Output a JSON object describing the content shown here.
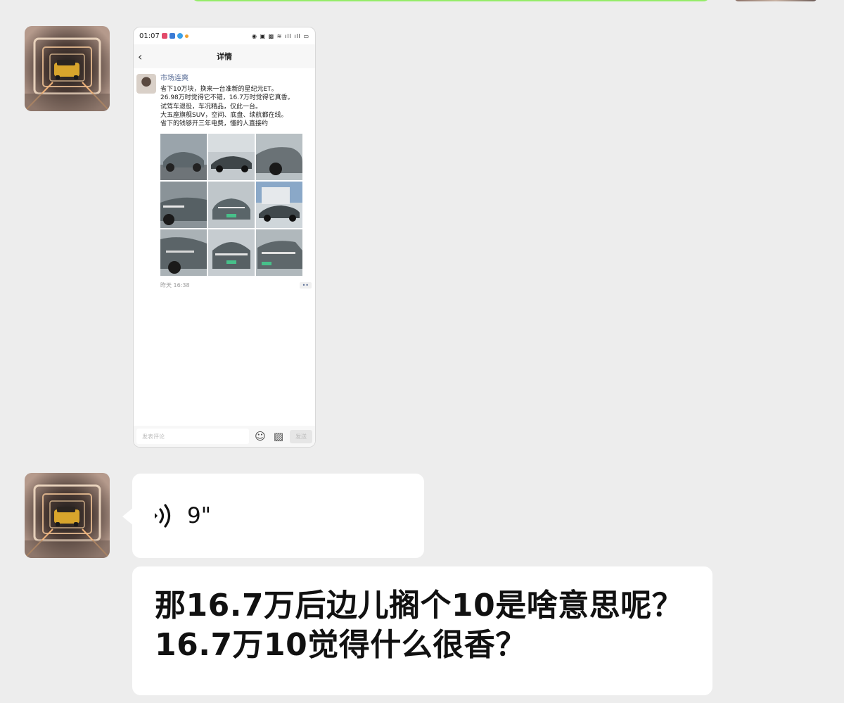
{
  "screenshot": {
    "status_time": "01:07",
    "nav_title": "详情",
    "post": {
      "author": "市场连爽",
      "text": "省下10万块，换来一台准新的星纪元ET。\n26.98万时觉得它不错，16.7万时觉得它真香。\n试驾车退役，车况精品，仅此一台。\n大五座旗舰SUV，空间、底盘、续航都在线。\n省下的钱够开三年电费，懂的人直接约",
      "time": "昨天 16:38",
      "more": "••"
    },
    "comment_placeholder": "发表评论",
    "send_label": "发送"
  },
  "voice_message": {
    "duration": "9\""
  },
  "text_message": {
    "content": "那16.7万后边儿搁个10是啥意思呢？16.7万10觉得什么很香？"
  },
  "colors": {
    "chat_background": "#ededed",
    "bubble": "#ffffff",
    "sent_bubble": "#95ec69",
    "link_name": "#576b95"
  }
}
